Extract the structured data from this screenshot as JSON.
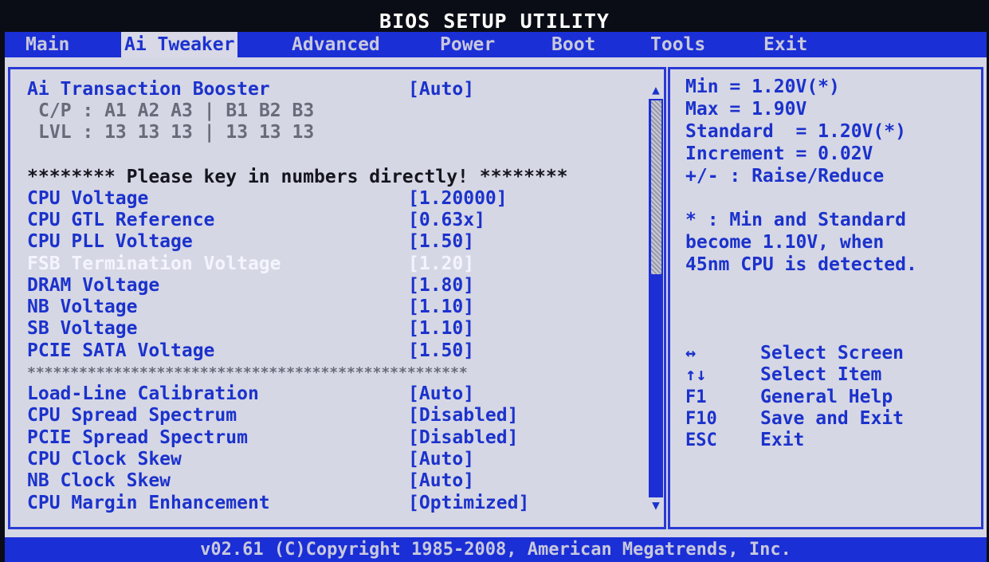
{
  "title": "BIOS SETUP UTILITY",
  "tabs": [
    "Main",
    "Ai Tweaker",
    "Advanced",
    "Power",
    "Boot",
    "Tools",
    "Exit"
  ],
  "active_tab": "Ai Tweaker",
  "settings_top": {
    "transaction_booster": {
      "label": "Ai Transaction Booster",
      "value": "[Auto]"
    },
    "cp_line": "C/P : A1 A2 A3 | B1 B2 B3",
    "lvl_line": "LVL : 13 13 13 | 13 13 13",
    "notice": "******** Please key in numbers directly! ********"
  },
  "voltages": [
    {
      "label": "CPU Voltage",
      "value": "[1.20000]"
    },
    {
      "label": "CPU GTL Reference",
      "value": "[0.63x]"
    },
    {
      "label": "CPU PLL Voltage",
      "value": "[1.50]"
    },
    {
      "label": "FSB Termination Voltage",
      "value": "[1.20]"
    },
    {
      "label": "DRAM Voltage",
      "value": "[1.80]"
    },
    {
      "label": "NB Voltage",
      "value": "[1.10]"
    },
    {
      "label": "SB Voltage",
      "value": "[1.10]"
    },
    {
      "label": "PCIE SATA Voltage",
      "value": "[1.50]"
    }
  ],
  "selected_item": "FSB Termination Voltage",
  "separator": "***************************************************",
  "other_settings": [
    {
      "label": "Load-Line Calibration",
      "value": "[Auto]"
    },
    {
      "label": "CPU Spread Spectrum",
      "value": "[Disabled]"
    },
    {
      "label": "PCIE Spread Spectrum",
      "value": "[Disabled]"
    },
    {
      "label": "CPU Clock Skew",
      "value": "[Auto]"
    },
    {
      "label": "NB Clock Skew",
      "value": "[Auto]"
    },
    {
      "label": "CPU Margin Enhancement",
      "value": "[Optimized]"
    }
  ],
  "help": {
    "lines": [
      "Min = 1.20V(*)",
      "Max = 1.90V",
      "Standard  = 1.20V(*)",
      "Increment = 0.02V",
      "+/- : Raise/Reduce"
    ],
    "note": [
      "* : Min and Standard",
      "become 1.10V, when",
      "45nm CPU is detected."
    ]
  },
  "keys": [
    {
      "key": "↔",
      "desc": "Select Screen"
    },
    {
      "key": "↑↓",
      "desc": "Select Item"
    },
    {
      "key": "F1",
      "desc": "General Help"
    },
    {
      "key": "F10",
      "desc": "Save and Exit"
    },
    {
      "key": "ESC",
      "desc": "Exit"
    }
  ],
  "footer": "v02.61 (C)Copyright 1985-2008, American Megatrends, Inc.",
  "colors": {
    "bios_blue": "#1a2fd6",
    "panel_grey": "#d6d7e4",
    "text_blue": "#1b32cc",
    "highlight_white": "#f4f4ff"
  },
  "icons": {
    "scroll_up": "up-triangle",
    "scroll_down": "down-triangle"
  }
}
